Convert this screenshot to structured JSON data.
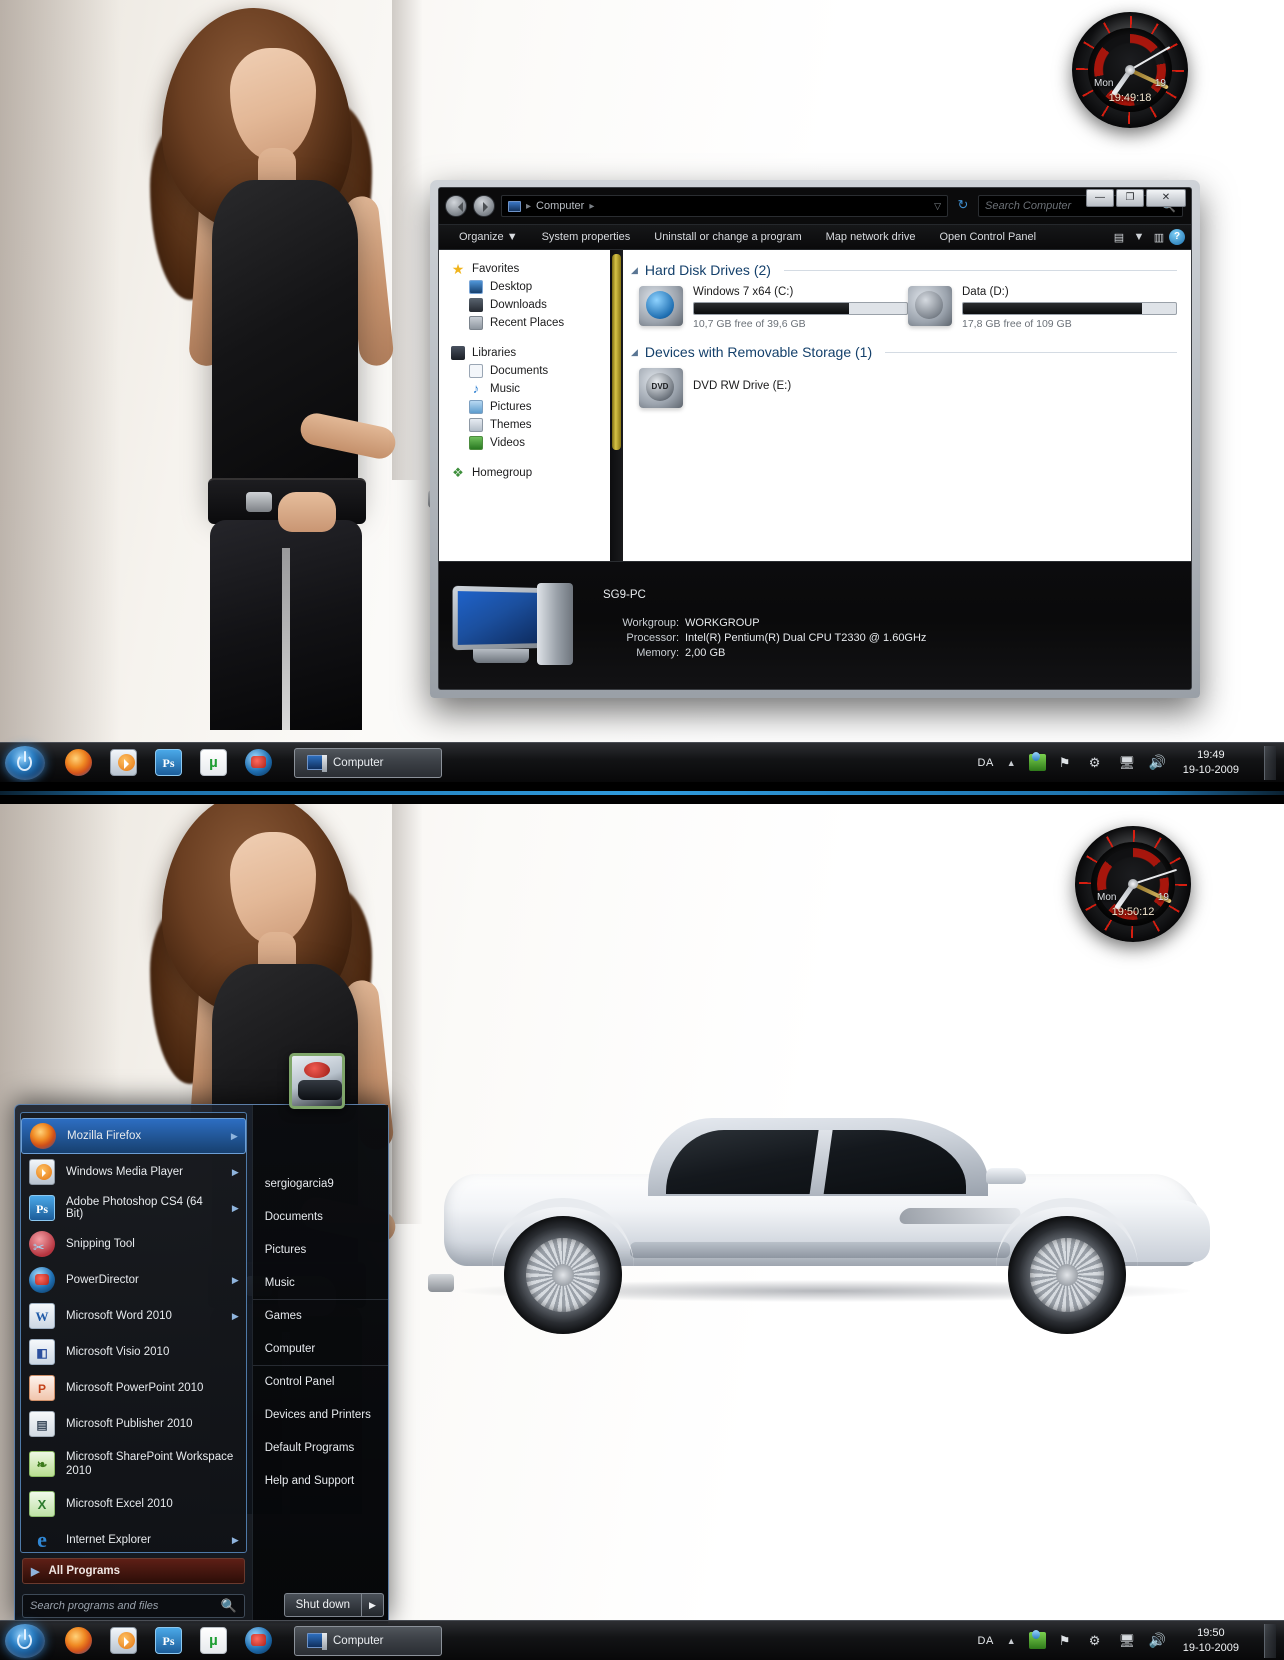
{
  "desktop": {
    "wallpaper_alt": "woman-in-black-outfit-wallpaper",
    "wallpaper2_alt": "white-lamborghini-gallardo-wallpaper"
  },
  "gadget_top": {
    "name": "clock-gadget",
    "day": "Mon",
    "date": "19",
    "time": "19:49:18"
  },
  "gadget_bottom": {
    "name": "clock-gadget",
    "day": "Mon",
    "date": "19",
    "time": "19:50:12"
  },
  "explorer": {
    "window_title": "Computer",
    "window_buttons": {
      "minimize": "—",
      "maximize": "❐",
      "close": "✕"
    },
    "address": {
      "crumb_root": "Computer",
      "sep": "▸",
      "dropdown_caret": "▽",
      "refresh_icon": "refresh-icon"
    },
    "search": {
      "placeholder": "Search Computer",
      "icon": "search-icon"
    },
    "toolbar": {
      "organize": "Organize",
      "organize_caret": "▼",
      "system_properties": "System properties",
      "uninstall": "Uninstall or change a program",
      "map_drive": "Map network drive",
      "control_panel": "Open Control Panel",
      "view_icon": "view-layout-icon",
      "view_caret": "▼",
      "preview_icon": "preview-pane-icon",
      "help_label": "?"
    },
    "navpane": {
      "favorites": {
        "label": "Favorites",
        "icon": "star-icon"
      },
      "favorites_items": [
        {
          "label": "Desktop",
          "icon": "desktop-icon"
        },
        {
          "label": "Downloads",
          "icon": "downloads-icon"
        },
        {
          "label": "Recent Places",
          "icon": "recent-places-icon"
        }
      ],
      "libraries": {
        "label": "Libraries",
        "icon": "libraries-icon"
      },
      "libraries_items": [
        {
          "label": "Documents",
          "icon": "documents-icon"
        },
        {
          "label": "Music",
          "icon": "music-icon"
        },
        {
          "label": "Pictures",
          "icon": "pictures-icon"
        },
        {
          "label": "Themes",
          "icon": "themes-icon"
        },
        {
          "label": "Videos",
          "icon": "videos-icon"
        }
      ],
      "homegroup": {
        "label": "Homegroup",
        "icon": "homegroup-icon"
      }
    },
    "groups": [
      {
        "header": "Hard Disk Drives (2)",
        "items": [
          {
            "name": "Windows 7 x64 (C:)",
            "free_text": "10,7 GB free of 39,6 GB",
            "used_percent": 73,
            "icon": "windows-drive-icon"
          },
          {
            "name": "Data (D:)",
            "free_text": "17,8 GB free of 109 GB",
            "used_percent": 84,
            "icon": "hard-drive-icon"
          }
        ]
      },
      {
        "header": "Devices with Removable Storage (1)",
        "items": [
          {
            "name": "DVD RW Drive (E:)",
            "free_text": "",
            "used_percent": 0,
            "icon": "dvd-drive-icon"
          }
        ]
      }
    ],
    "details": {
      "computer_name": "SG9-PC",
      "rows": [
        {
          "key": "Workgroup:",
          "value": "WORKGROUP"
        },
        {
          "key": "Processor:",
          "value": "Intel(R) Pentium(R) Dual  CPU  T2330  @ 1.60GHz"
        },
        {
          "key": "Memory:",
          "value": "2,00 GB"
        }
      ]
    }
  },
  "taskbar_top": {
    "start_icon": "windows-start-orb",
    "quick_launch": [
      {
        "name": "firefox-icon",
        "label": "Mozilla Firefox"
      },
      {
        "name": "windows-media-player-icon",
        "label": "Windows Media Player"
      },
      {
        "name": "photoshop-icon",
        "label": "Ps"
      },
      {
        "name": "utorrent-icon",
        "label": "µ"
      },
      {
        "name": "powerdirector-icon",
        "label": "PowerDirector"
      }
    ],
    "active_task": {
      "label": "Computer",
      "icon": "computer-window-icon"
    },
    "tray": {
      "language": "DA",
      "chevron": "▲",
      "icons": [
        "network-icon",
        "action-center-flag-icon",
        "settings-gear-icon",
        "monitor-icon",
        "volume-icon"
      ],
      "flag_glyph": "⚑",
      "gear_glyph": "⚙",
      "monitor_glyph": "🖥",
      "volume_glyph": "🔊"
    },
    "clock": {
      "time": "19:49",
      "date": "19-10-2009"
    }
  },
  "taskbar_bottom": {
    "start_icon": "windows-start-orb",
    "quick_launch": [
      {
        "name": "firefox-icon",
        "label": "Mozilla Firefox"
      },
      {
        "name": "windows-media-player-icon",
        "label": "Windows Media Player"
      },
      {
        "name": "photoshop-icon",
        "label": "Ps"
      },
      {
        "name": "utorrent-icon",
        "label": "µ"
      },
      {
        "name": "powerdirector-icon",
        "label": "PowerDirector"
      }
    ],
    "active_task": {
      "label": "Computer",
      "icon": "computer-window-icon"
    },
    "tray": {
      "language": "DA",
      "chevron": "▲",
      "flag_glyph": "⚑",
      "gear_glyph": "⚙",
      "monitor_glyph": "🖥",
      "volume_glyph": "🔊"
    },
    "clock": {
      "time": "19:50",
      "date": "19-10-2009"
    }
  },
  "start_menu": {
    "user_name": "sergiogarcia9",
    "avatar": "user-avatar",
    "programs": [
      {
        "label": "Mozilla Firefox",
        "icon": "firefox-icon",
        "has_submenu": true,
        "selected": true
      },
      {
        "label": "Windows Media Player",
        "icon": "windows-media-player-icon",
        "has_submenu": true,
        "selected": false
      },
      {
        "label": "Adobe Photoshop CS4 (64 Bit)",
        "icon": "photoshop-icon",
        "has_submenu": true,
        "selected": false
      },
      {
        "label": "Snipping Tool",
        "icon": "snipping-tool-icon",
        "has_submenu": false,
        "selected": false
      },
      {
        "label": "PowerDirector",
        "icon": "powerdirector-icon",
        "has_submenu": true,
        "selected": false
      },
      {
        "label": "Microsoft Word 2010",
        "icon": "word-icon",
        "has_submenu": true,
        "selected": false
      },
      {
        "label": "Microsoft Visio 2010",
        "icon": "visio-icon",
        "has_submenu": false,
        "selected": false
      },
      {
        "label": "Microsoft PowerPoint 2010",
        "icon": "powerpoint-icon",
        "has_submenu": false,
        "selected": false
      },
      {
        "label": "Microsoft Publisher 2010",
        "icon": "publisher-icon",
        "has_submenu": false,
        "selected": false
      },
      {
        "label": "Microsoft SharePoint Workspace 2010",
        "icon": "sharepoint-workspace-icon",
        "has_submenu": false,
        "selected": false
      },
      {
        "label": "Microsoft Excel 2010",
        "icon": "excel-icon",
        "has_submenu": false,
        "selected": false
      },
      {
        "label": "Internet Explorer",
        "icon": "internet-explorer-icon",
        "has_submenu": true,
        "selected": false
      }
    ],
    "all_programs": {
      "label": "All Programs",
      "triangle": "▶"
    },
    "search": {
      "placeholder": "Search programs and files",
      "icon": "search-icon"
    },
    "right_items": [
      {
        "label": "sergiogarcia9",
        "divider": false
      },
      {
        "label": "Documents",
        "divider": false
      },
      {
        "label": "Pictures",
        "divider": false
      },
      {
        "label": "Music",
        "divider": false
      },
      {
        "label": "Games",
        "divider": true
      },
      {
        "label": "Computer",
        "divider": false
      },
      {
        "label": "Control Panel",
        "divider": true
      },
      {
        "label": "Devices and Printers",
        "divider": false
      },
      {
        "label": "Default Programs",
        "divider": false
      },
      {
        "label": "Help and Support",
        "divider": false
      }
    ],
    "shutdown": {
      "label": "Shut down",
      "arrow": "▶"
    }
  },
  "colors": {
    "accent_blue": "#2d6ec2",
    "gadget_red": "#c9180c",
    "allprograms_red": "#5e1f16",
    "header_blue": "#14406b"
  }
}
